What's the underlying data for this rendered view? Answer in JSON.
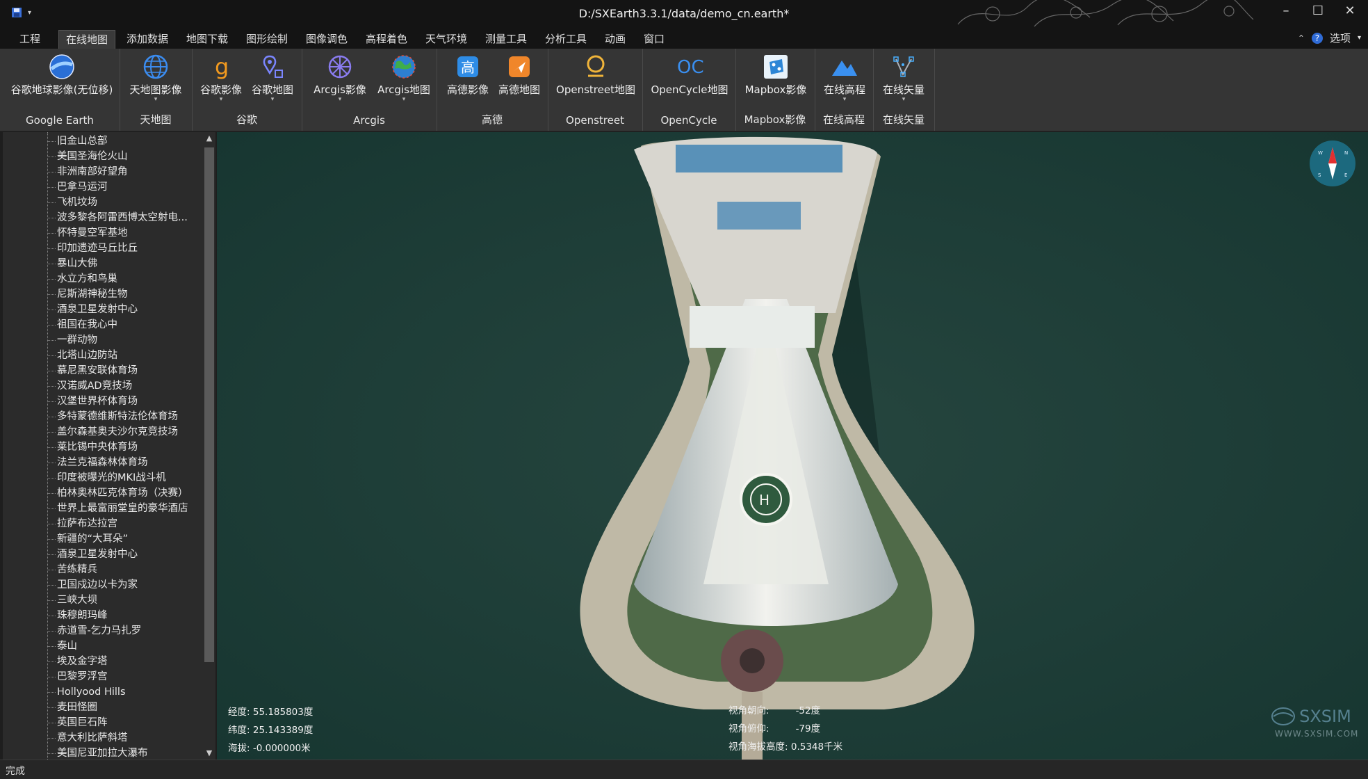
{
  "window": {
    "title": "D:/SXEarth3.3.1/data/demo_cn.earth*",
    "controls": [
      "minimize",
      "maximize",
      "close"
    ]
  },
  "menu": {
    "tabs": [
      "工程",
      "在线地图",
      "添加数据",
      "地图下载",
      "图形绘制",
      "图像调色",
      "高程着色",
      "天气环境",
      "测量工具",
      "分析工具",
      "动画",
      "窗口"
    ],
    "active_tab": "在线地图",
    "options_label": "选项"
  },
  "ribbon": {
    "groups": [
      {
        "label": "Google Earth",
        "buttons": [
          {
            "label": "谷歌地球影像(无位移)",
            "icon": "google-earth-icon"
          }
        ]
      },
      {
        "label": "天地图",
        "buttons": [
          {
            "label": "天地图影像",
            "icon": "tianditu-globe-icon"
          }
        ]
      },
      {
        "label": "谷歌",
        "buttons": [
          {
            "label": "谷歌影像",
            "icon": "google-g-icon"
          },
          {
            "label": "谷歌地图",
            "icon": "google-map-pin-icon"
          }
        ]
      },
      {
        "label": "Arcgis",
        "buttons": [
          {
            "label": "Arcgis影像",
            "icon": "arcgis-imagery-icon"
          },
          {
            "label": "Arcgis地图",
            "icon": "arcgis-globe-icon"
          }
        ]
      },
      {
        "label": "高德",
        "buttons": [
          {
            "label": "高德影像",
            "icon": "gaode-imagery-icon"
          },
          {
            "label": "高德地图",
            "icon": "gaode-map-icon"
          }
        ]
      },
      {
        "label": "Openstreet",
        "buttons": [
          {
            "label": "Openstreet地图",
            "icon": "openstreet-icon"
          }
        ]
      },
      {
        "label": "OpenCycle",
        "buttons": [
          {
            "label": "OpenCycle地图",
            "icon": "opencycle-icon"
          }
        ]
      },
      {
        "label": "Mapbox影像",
        "buttons": [
          {
            "label": "Mapbox影像",
            "icon": "mapbox-icon"
          }
        ]
      },
      {
        "label": "在线高程",
        "buttons": [
          {
            "label": "在线高程",
            "icon": "elevation-mountain-icon"
          }
        ]
      },
      {
        "label": "在线矢量",
        "buttons": [
          {
            "label": "在线矢量",
            "icon": "vector-icon"
          }
        ]
      }
    ]
  },
  "sidebar": {
    "items": [
      "旧金山总部",
      "美国圣海伦火山",
      "非洲南部好望角",
      "巴拿马运河",
      "飞机坟场",
      "波多黎各阿雷西博太空射电...",
      "怀特曼空军基地",
      "印加遗迹马丘比丘",
      "暴山大佛",
      "水立方和鸟巢",
      "尼斯湖神秘生物",
      "酒泉卫星发射中心",
      "祖国在我心中",
      "一群动物",
      "北塔山边防站",
      "慕尼黑安联体育场",
      "汉诺威AD竞技场",
      "汉堡世界杯体育场",
      "多特蒙德维斯特法伦体育场",
      "盖尔森基奥夫沙尔克竞技场",
      "莱比锡中央体育场",
      "法兰克福森林体育场",
      "印度被曝光的MKI战斗机",
      "柏林奥林匹克体育场（决赛）",
      "世界上最富丽堂皇的豪华酒店",
      "拉萨布达拉宫",
      "新疆的“大耳朵”",
      "酒泉卫星发射中心",
      "苦练精兵",
      "卫国戍边以卡为家",
      "三峡大坝",
      "珠穆朗玛峰",
      "赤道雪-乞力马扎罗",
      "泰山",
      "埃及金字塔",
      "巴黎罗浮宫",
      "Hollyood Hills",
      "麦田怪圈",
      "英国巨石阵",
      "意大利比萨斜塔",
      "美国尼亚加拉大瀑布"
    ]
  },
  "map": {
    "longitude_label": "经度:",
    "longitude_value": "55.185803度",
    "latitude_label": "纬度:",
    "latitude_value": "25.143389度",
    "altitude_label": "海拔:",
    "altitude_value": "-0.000000米",
    "heading_label": "视角朝向:",
    "heading_value": "-52度",
    "pitch_label": "视角俯仰:",
    "pitch_value": "-79度",
    "view_alt_label": "视角海拔高度:",
    "view_alt_value": "0.5348千米",
    "watermark_brand": "SXSIM",
    "watermark_url": "WWW.SXSIM.COM",
    "compass_icon": "compass-icon"
  },
  "status": {
    "text": "完成"
  }
}
